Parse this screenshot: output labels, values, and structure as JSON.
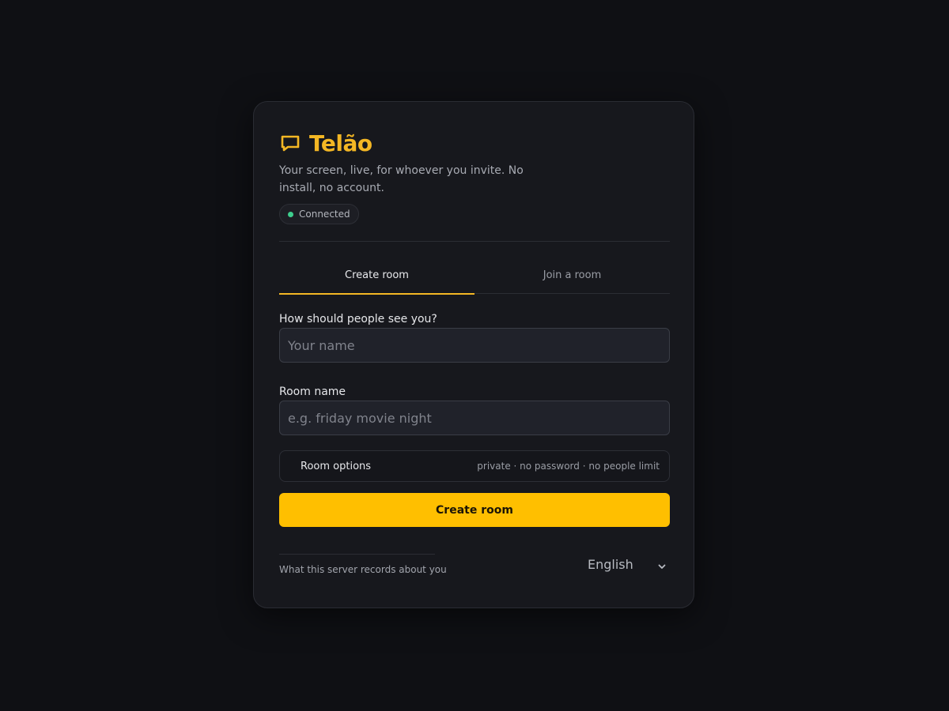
{
  "app": {
    "title": "Telão",
    "tagline": "Your screen, live, for whoever you invite. No install, no account.",
    "status": "Connected"
  },
  "tabs": [
    {
      "label": "Create room",
      "active": true
    },
    {
      "label": "Join a room",
      "active": false
    }
  ],
  "form": {
    "name_label": "How should people see you?",
    "name_placeholder": "Your name",
    "name_value": "",
    "room_label": "Room name",
    "room_placeholder": "e.g. friday movie night",
    "room_value": ""
  },
  "options": {
    "title": "Room options",
    "summary": "private · no password · no people limit"
  },
  "submit_label": "Create room",
  "footer": {
    "privacy_link": "What this server records about you",
    "language": "English"
  },
  "colors": {
    "accent": "#ffbf00",
    "brand": "#f4b724",
    "background": "#0f1014",
    "card": "#17181d",
    "status_dot": "#3ecf8e"
  },
  "icons": {
    "brand": "chat-bubble-icon",
    "status": "status-dot-icon",
    "language": "chevron-down-icon"
  }
}
